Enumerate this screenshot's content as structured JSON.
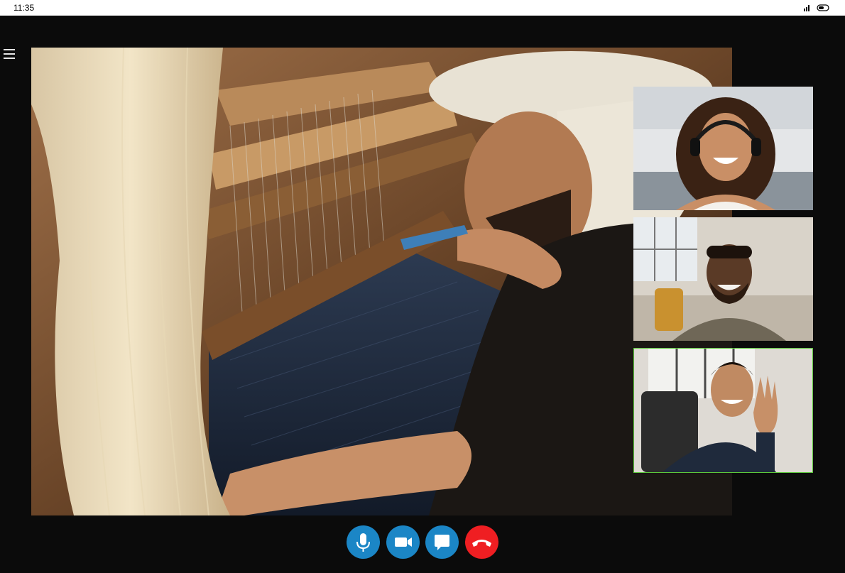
{
  "status_bar": {
    "time": "11:35",
    "icons": [
      "signal-icon",
      "battery-icon"
    ]
  },
  "menu": {
    "icon": "hamburger-menu-icon"
  },
  "main_video": {
    "scene": "weaving-loom"
  },
  "participants": [
    {
      "tile": "woman-with-headphones",
      "active_speaker": false
    },
    {
      "tile": "man-smiling",
      "active_speaker": false
    },
    {
      "tile": "man-waving",
      "active_speaker": true
    }
  ],
  "controls": {
    "mic": {
      "icon": "microphone-icon"
    },
    "camera": {
      "icon": "video-camera-icon"
    },
    "chat": {
      "icon": "chat-bubble-icon"
    },
    "end_call": {
      "icon": "hang-up-icon"
    }
  },
  "colors": {
    "control_blue": "#1b86c6",
    "end_call_red": "#ef1e22",
    "active_speaker_border": "#5cc93b",
    "status_bar_bg": "#ffffff",
    "call_bg": "#0b0b0b"
  }
}
